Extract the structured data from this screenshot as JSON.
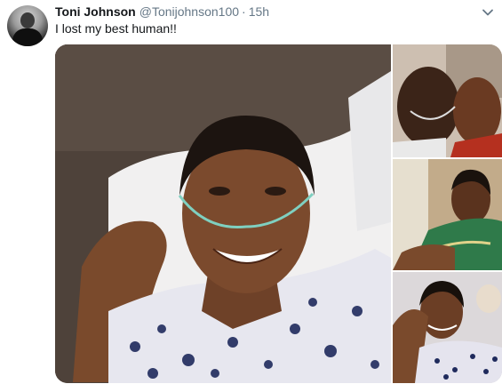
{
  "tweet": {
    "display_name": "Toni Johnson",
    "handle": "@Tonijohnson100",
    "separator": "·",
    "time": "15h",
    "text": "I lost my best human!!"
  },
  "icons": {
    "avatar": "user-avatar",
    "menu": "chevron-down-icon"
  },
  "colors": {
    "name": "#14171a",
    "meta": "#657786"
  },
  "media": {
    "photo_count": 4
  }
}
